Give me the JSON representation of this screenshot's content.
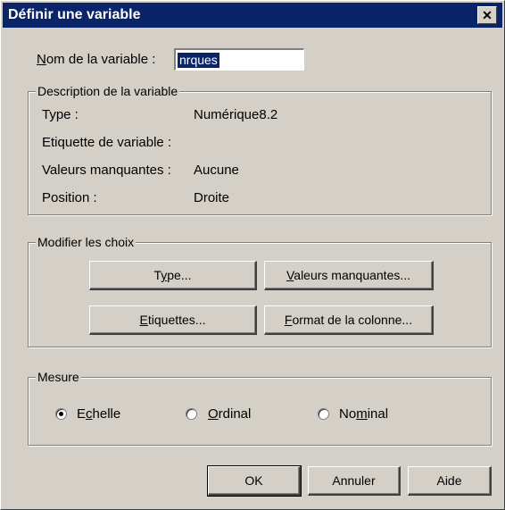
{
  "dialog": {
    "title": "Définir une variable",
    "close_symbol": "✕"
  },
  "name_field": {
    "label_underlined": "N",
    "label_rest": "om de la variable :",
    "value": "nrques"
  },
  "description": {
    "legend": "Description de la variable",
    "rows": [
      {
        "label": "Type :",
        "value": "Numérique8.2"
      },
      {
        "label": "Etiquette de variable :",
        "value": ""
      },
      {
        "label": "Valeurs manquantes :",
        "value": "Aucune"
      },
      {
        "label": "Position :",
        "value": "Droite"
      }
    ]
  },
  "modify": {
    "legend": "Modifier les choix",
    "buttons": [
      {
        "pre": "T",
        "ul": "y",
        "post": "pe..."
      },
      {
        "pre": "",
        "ul": "V",
        "post": "aleurs manquantes..."
      },
      {
        "pre": "",
        "ul": "E",
        "post": "tiquettes..."
      },
      {
        "pre": "",
        "ul": "F",
        "post": "ormat de la colonne..."
      }
    ]
  },
  "measure": {
    "legend": "Mesure",
    "options": [
      {
        "pre": "E",
        "ul": "c",
        "post": "helle",
        "selected": true
      },
      {
        "pre": "",
        "ul": "O",
        "post": "rdinal",
        "selected": false
      },
      {
        "pre": "No",
        "ul": "m",
        "post": "inal",
        "selected": false
      }
    ]
  },
  "footer": {
    "ok": "OK",
    "cancel": "Annuler",
    "help": "Aide"
  },
  "colors": {
    "titlebar": "#0a246a",
    "face": "#d4d0c8"
  }
}
